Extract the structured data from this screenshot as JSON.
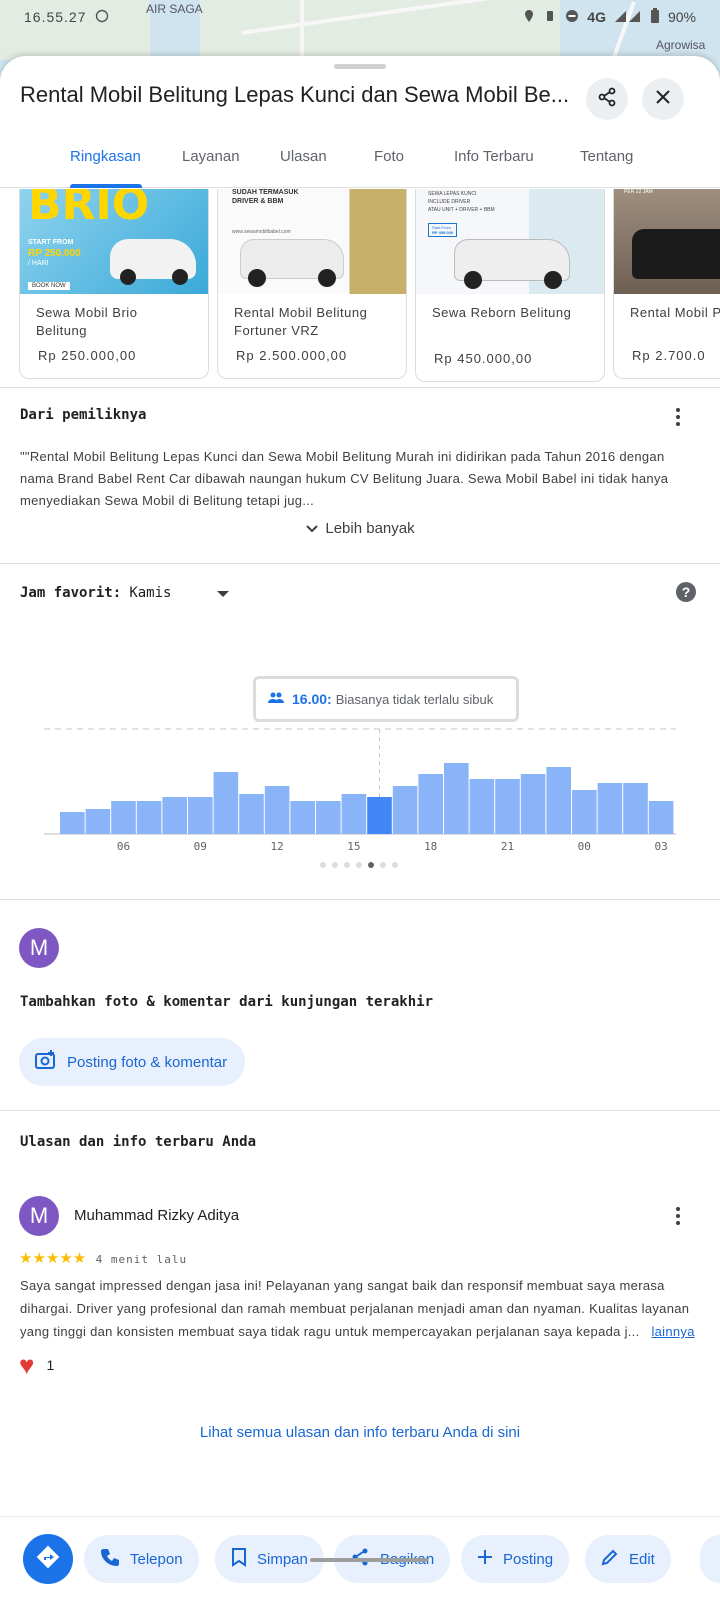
{
  "status_bar": {
    "time": "16.55.27",
    "network": "4G",
    "battery": "90%"
  },
  "map": {
    "labels": [
      "AIR SAGA",
      "Agrowisa"
    ]
  },
  "place": {
    "title": "Rental Mobil Belitung Lepas Kunci dan Sewa Mobil Be...",
    "share_icon": "share-icon",
    "close_icon": "close-icon"
  },
  "tabs": [
    {
      "label": "Ringkasan",
      "active": true
    },
    {
      "label": "Layanan",
      "active": false
    },
    {
      "label": "Ulasan",
      "active": false
    },
    {
      "label": "Foto",
      "active": false
    },
    {
      "label": "Info Terbaru",
      "active": false
    },
    {
      "label": "Tentang",
      "active": false
    }
  ],
  "products": [
    {
      "name": "Sewa Mobil Brio Belitung",
      "price": "Rp 250.000,00",
      "img_title": "BRIO",
      "img_line1": "START FROM",
      "img_line2": "RP 250.000",
      "img_line3": "/ HARI",
      "img_btn": "BOOK NOW"
    },
    {
      "name": "Rental Mobil Belitung Fortuner VRZ",
      "price": "Rp 2.500.000,00",
      "img_line1": "SUDAH TERMASUK",
      "img_line2": "DRIVER & BBM",
      "img_url": "www.sewamobilbabel.com"
    },
    {
      "name": "Sewa Reborn Belitung",
      "price": "Rp 450.000,00",
      "img_line1": "SEWA LEPAS KUNCI",
      "img_line2": "INCLUDE DRIVER",
      "img_line3": "ATAU UNIT + DRIVER + BBM",
      "img_badge1": "Start From",
      "img_badge2": "RP 499.000"
    },
    {
      "name": "Rental Mobil Pajero Sport",
      "price": "Rp 2.700.0",
      "img_line1": "PER 12 JAM"
    }
  ],
  "owner": {
    "heading": "Dari pemiliknya",
    "text": "\"\"Rental Mobil Belitung Lepas Kunci dan Sewa Mobil Belitung Murah ini didirikan pada Tahun 2016 dengan nama Brand Babel Rent Car dibawah naungan hukum CV Belitung Juara. Sewa Mobil Babel ini tidak hanya menyediakan Sewa Mobil di Belitung tetapi jug...",
    "more_label": "Lebih banyak"
  },
  "popular_times": {
    "label": "Jam favorit:",
    "day": "Kamis",
    "tooltip_hour": "16.00:",
    "tooltip_text": "Biasanya tidak terlalu sibuk",
    "pager_count": 7,
    "pager_active": 4
  },
  "chart_data": {
    "type": "bar",
    "categories": [
      "04",
      "05",
      "06",
      "07",
      "08",
      "09",
      "10",
      "11",
      "12",
      "13",
      "14",
      "15",
      "16",
      "17",
      "18",
      "19",
      "20",
      "21",
      "22",
      "23",
      "00",
      "01",
      "02",
      "03",
      "04"
    ],
    "values": [
      22,
      25,
      33,
      33,
      37,
      37,
      62,
      40,
      48,
      33,
      33,
      40,
      37,
      48,
      60,
      71,
      55,
      55,
      60,
      67,
      44,
      51,
      51,
      33
    ],
    "highlight_index": 12,
    "tick_labels": [
      "06",
      "09",
      "12",
      "15",
      "18",
      "21",
      "00",
      "03"
    ],
    "ylim": [
      0,
      100
    ],
    "grid": false,
    "title": "",
    "xlabel": "",
    "ylabel": ""
  },
  "add_photo": {
    "avatar_letter": "M",
    "heading": "Tambahkan foto & komentar dari kunjungan terakhir",
    "button_label": "Posting foto & komentar"
  },
  "reviews": {
    "heading": "Ulasan dan info terbaru Anda",
    "author_initial": "M",
    "author": "Muhammad Rizky Aditya",
    "stars": "★★★★★",
    "rating": 5,
    "time": "4 menit lalu",
    "text": "Saya sangat impressed dengan jasa ini! Pelayanan yang sangat baik dan responsif membuat saya merasa dihargai. Driver yang profesional dan ramah membuat perjalanan menjadi aman dan nyaman. Kualitas layanan yang tinggi dan konsisten membuat saya tidak ragu untuk mempercayakan perjalanan saya kepada j...",
    "more_label": "lainnya",
    "reaction_emoji": "❤️",
    "reaction_count": "1",
    "see_all": "Lihat semua ulasan dan info terbaru Anda di sini"
  },
  "actions": {
    "telepon": "Telepon",
    "simpan": "Simpan",
    "bagikan": "Bagikan",
    "posting": "Posting",
    "edit": "Edit"
  },
  "colors": {
    "accent": "#1a73e8",
    "bar": "#8ab4f8",
    "bar_highlight": "#4285f4",
    "avatar": "#7e57c2",
    "star": "#fbbc04"
  }
}
